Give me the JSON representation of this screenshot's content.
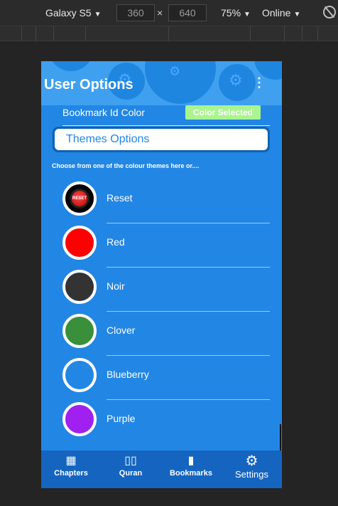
{
  "devtools": {
    "device": "Galaxy S5",
    "width": "360",
    "height": "640",
    "times": "×",
    "zoom": "75%",
    "network": "Online"
  },
  "header": {
    "title": "User Options"
  },
  "bookmark": {
    "label": "Bookmark Id Color",
    "status": "Color Selected",
    "status_color": "#a9f58f"
  },
  "themes": {
    "box_label": "Themes Options",
    "hint": "Choose from one of the colour themes here or....",
    "options": [
      {
        "name": "Reset",
        "color": "#000000"
      },
      {
        "name": "Red",
        "color": "#ff0000"
      },
      {
        "name": "Noir",
        "color": "#333333"
      },
      {
        "name": "Clover",
        "color": "#3a8f3a"
      },
      {
        "name": "Blueberry",
        "color": "#2286e5"
      },
      {
        "name": "Purple",
        "color": "#a020f0"
      }
    ],
    "reset_text": "RESET"
  },
  "nav": [
    {
      "label": "Chapters",
      "icon": "grid-icon"
    },
    {
      "label": "Quran",
      "icon": "book-open-icon"
    },
    {
      "label": "Bookmarks",
      "icon": "bookmark-book-icon"
    },
    {
      "label": "Settings",
      "icon": "gear-icon"
    }
  ],
  "colors": {
    "primary": "#2286e5",
    "header": "#3fa0f0",
    "nav": "#1565c0"
  }
}
